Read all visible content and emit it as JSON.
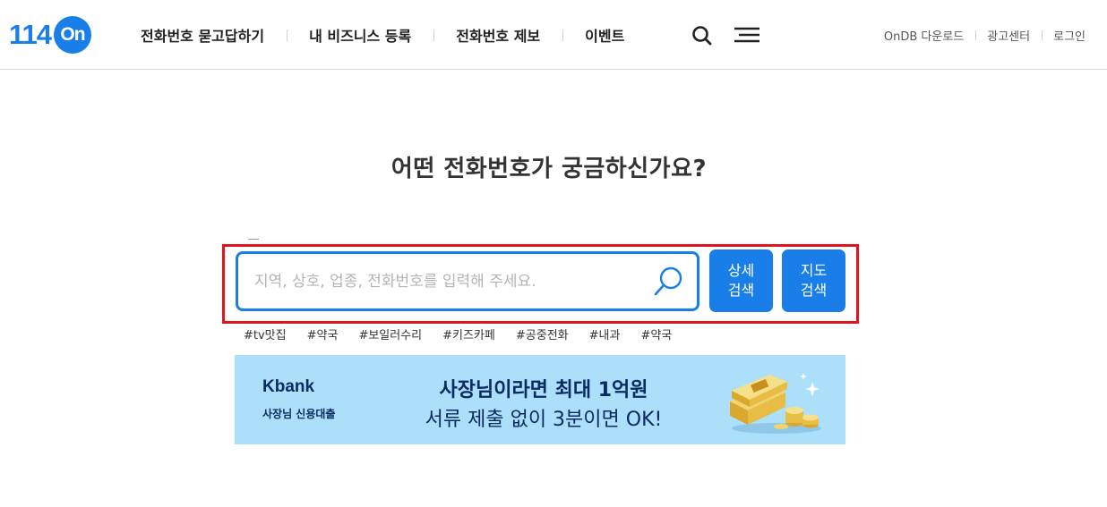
{
  "logo": {
    "number": "114",
    "circle": "On"
  },
  "nav": {
    "items": [
      {
        "label": "전화번호 묻고답하기"
      },
      {
        "label": "내 비즈니스 등록"
      },
      {
        "label": "전화번호 제보"
      },
      {
        "label": "이벤트"
      }
    ]
  },
  "util": {
    "items": [
      {
        "label": "OnDB 다운로드"
      },
      {
        "label": "광고센터"
      },
      {
        "label": "로그인"
      }
    ]
  },
  "main": {
    "headline": "어떤 전화번호가 궁금하신가요?",
    "search": {
      "value": "",
      "placeholder": "지역, 상호, 업종, 전화번호를 입력해 주세요."
    },
    "detail_button": {
      "line1": "상세",
      "line2": "검색"
    },
    "map_button": {
      "line1": "지도",
      "line2": "검색"
    },
    "tags": [
      "#tv맛집",
      "#약국",
      "#보일러수리",
      "#키즈카페",
      "#공중전화",
      "#내과",
      "#약국"
    ]
  },
  "banner": {
    "brand": "Kbank",
    "subtitle": "사장님 신용대출",
    "headline": "사장님이라면 최대 1억원",
    "body": "서류 제출 없이 3분이면 OK!"
  },
  "icons": {
    "search": "search-icon",
    "menu": "hamburger-menu-icon",
    "search_submit": "magnifier-icon",
    "banner_art": "money-stack-icon"
  },
  "colors": {
    "brand_blue": "#1a7ee8",
    "highlight_red": "#e1141e",
    "banner_bg": "#abdffa",
    "banner_text": "#0b2a63"
  }
}
